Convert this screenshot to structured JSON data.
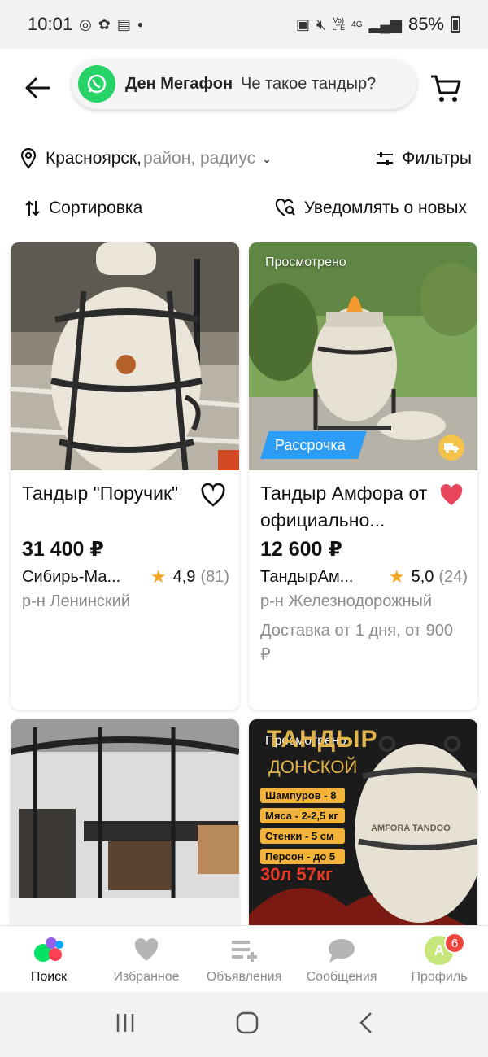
{
  "status_bar": {
    "time": "10:01",
    "battery": "85%",
    "net1": "Vo)\nLTE",
    "net2": "4G"
  },
  "header": {
    "search_contact": "Ден Мегафон",
    "search_message": "Че такое тандыр?"
  },
  "location": {
    "city": "Красноярск,",
    "rest": " район, радиус"
  },
  "filters_label": "Фильтры",
  "sort_label": "Сортировка",
  "notify_label": "Уведомлять о новых",
  "listings": [
    {
      "title": "Тандыр \"Поручик\"",
      "price": "31 400 ₽",
      "seller": "Сибирь-Ма...",
      "rating": "4,9",
      "reviews": "(81)",
      "district": "р-н Ленинский",
      "favorite": false
    },
    {
      "title": "Тандыр Амфора от официально...",
      "price": "12 600 ₽",
      "seller": "ТандырАм...",
      "rating": "5,0",
      "reviews": "(24)",
      "district": "р-н Железнодорожный",
      "delivery": "Доставка от 1 дня, от 900 ₽",
      "viewed": "Просмотрено",
      "installment": "Рассрочка",
      "favorite": true
    },
    {
      "title": "",
      "viewed": ""
    },
    {
      "viewed": "Просмотрено",
      "promo": {
        "title1": "ТАНДЫР",
        "title2": "ДОНСКОЙ",
        "specs": [
          "Шампуров - 8",
          "Мяса - 2-2,5 кг",
          "Стенки - 5 см",
          "Персон - до 5"
        ],
        "volume": "30л 57кг",
        "brand": "AMFORA TANDOO"
      }
    }
  ],
  "bottom_nav": [
    {
      "label": "Поиск",
      "icon": "search-dots-icon",
      "active": true
    },
    {
      "label": "Избранное",
      "icon": "heart-icon"
    },
    {
      "label": "Объявления",
      "icon": "add-listing-icon"
    },
    {
      "label": "Сообщения",
      "icon": "chat-icon"
    },
    {
      "label": "Профиль",
      "icon": "avatar-icon",
      "avatar_letter": "А",
      "badge": "6"
    }
  ],
  "colors": {
    "accent_blue": "#2d9cf5",
    "heart_red": "#e8455a",
    "star": "#f5a623",
    "whatsapp": "#25d366"
  }
}
